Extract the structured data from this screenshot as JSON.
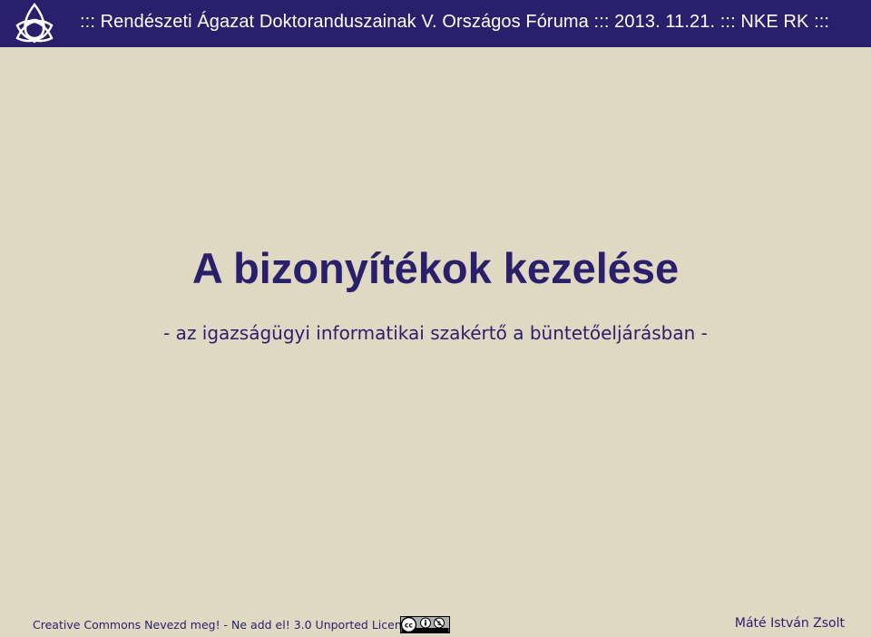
{
  "header": {
    "text": "::: Rendészeti Ágazat Doktoranduszainak V. Országos Fóruma  :::  2013. 11.21. :::  NKE RK  :::"
  },
  "slide": {
    "title": "A bizonyítékok kezelése",
    "subtitle": "- az igazságügyi informatikai szakértő a büntetőeljárásban -"
  },
  "footer": {
    "license": "Creative Commons Nevezd meg! - Ne add el! 3.0 Unported Licenc",
    "author": "Máté István Zsolt"
  },
  "icons": {
    "logo": "triquetra-logo-icon",
    "license_badge": "cc-by-nc-icon"
  },
  "colors": {
    "header_bg": "#2a1f6b",
    "slide_bg": "#dfd8c3",
    "text": "#2a1f6b"
  }
}
